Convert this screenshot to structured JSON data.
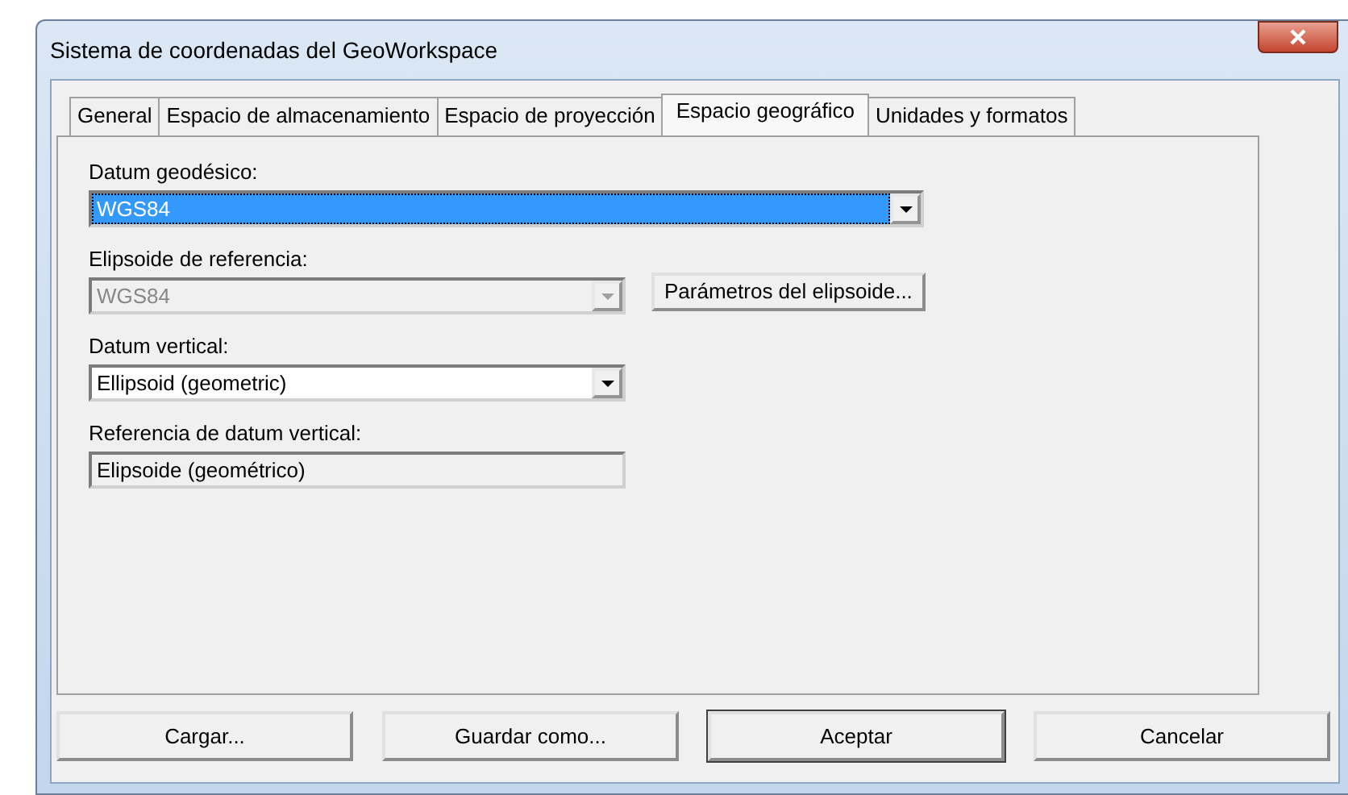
{
  "window": {
    "title": "Sistema de coordenadas del GeoWorkspace"
  },
  "tabs": [
    {
      "label": "General",
      "selected": false
    },
    {
      "label": "Espacio de almacenamiento",
      "selected": false
    },
    {
      "label": "Espacio de proyección",
      "selected": false
    },
    {
      "label": "Espacio geográfico",
      "selected": true
    },
    {
      "label": "Unidades y formatos",
      "selected": false
    }
  ],
  "fields": [
    {
      "label": "Datum geodésico:",
      "kind": "dropdown",
      "value": "WGS84",
      "highlighted": true,
      "disabled": false,
      "wide": true
    },
    {
      "label": "Elipsoide de referencia:",
      "kind": "dropdown",
      "value": "WGS84",
      "highlighted": false,
      "disabled": true,
      "wide": false,
      "button": "Parámetros del elipsoide..."
    },
    {
      "label": "Datum vertical:",
      "kind": "dropdown",
      "value": "Ellipsoid (geometric)",
      "highlighted": false,
      "disabled": false,
      "wide": false
    },
    {
      "label": "Referencia de datum vertical:",
      "kind": "readonly",
      "value": "Elipsoide (geométrico)",
      "wide": false
    }
  ],
  "buttons": [
    {
      "label": "Cargar...",
      "default": false
    },
    {
      "label": "Guardar como...",
      "default": false
    },
    {
      "label": "Aceptar",
      "default": true
    },
    {
      "label": "Cancelar",
      "default": false
    }
  ]
}
